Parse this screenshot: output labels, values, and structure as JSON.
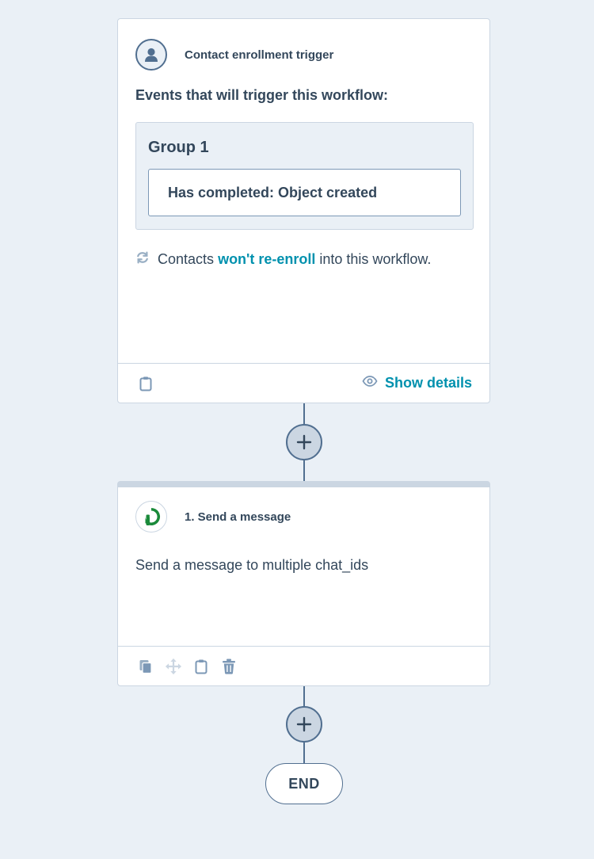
{
  "trigger": {
    "title": "Contact enrollment trigger",
    "icon": "contact-avatar-icon",
    "events_heading": "Events that will trigger this workflow:",
    "group": {
      "title": "Group 1",
      "filter": "Has completed: Object created"
    },
    "reenroll": {
      "prefix": "Contacts",
      "link": "won't re-enroll",
      "suffix": "into this workflow."
    },
    "footer": {
      "show_details": "Show details"
    }
  },
  "action": {
    "title": "1. Send a message",
    "icon": "app-logo-icon",
    "description": "Send a message to multiple chat_ids"
  },
  "end_label": "END",
  "colors": {
    "background": "#eaf0f6",
    "text": "#33475b",
    "link": "#0091ae",
    "border": "#cbd6e2",
    "connector": "#516f90",
    "app_logo": "#1a8a3a"
  }
}
